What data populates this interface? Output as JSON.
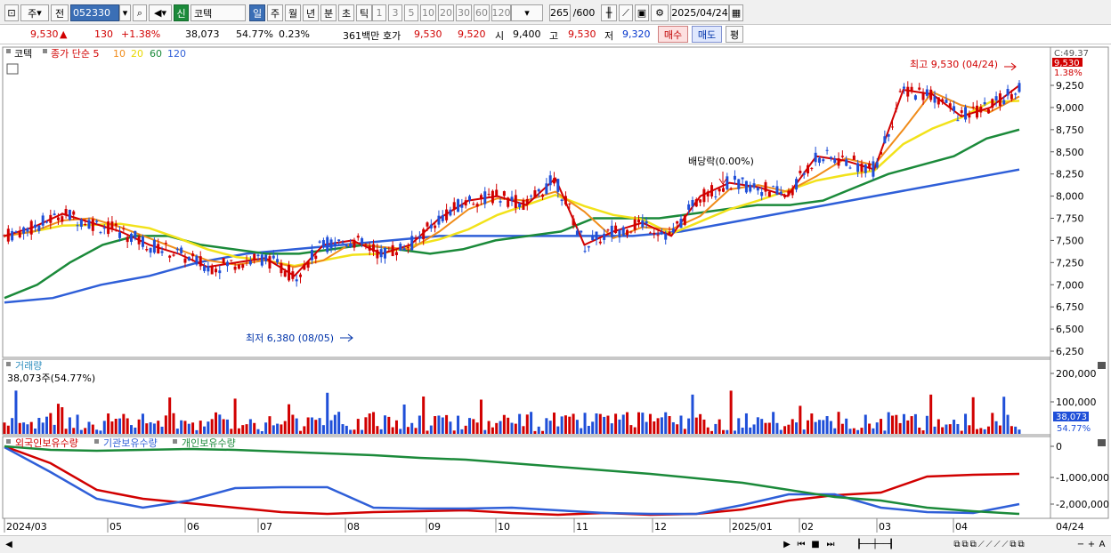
{
  "toolbar": {
    "period_main": "주",
    "prev_label": "전",
    "code": "052330",
    "new_label": "신",
    "name": "코텍",
    "tabs": [
      "일",
      "주",
      "월",
      "년",
      "분",
      "초",
      "틱"
    ],
    "active_tab": "일",
    "intervals": [
      "1",
      "3",
      "5",
      "10",
      "20",
      "30",
      "60",
      "120"
    ],
    "count": "265",
    "count_total": "/600",
    "date": "2025/04/24"
  },
  "quote": {
    "price": "9,530",
    "arrow": "▲",
    "change": "130",
    "change_pct": "+1.38%",
    "volume": "38,073",
    "vol_ratio": "54.77%",
    "turnover": "0.23%",
    "amount": "361백만",
    "bid_label": "호가",
    "ask": "9,530",
    "bid": "9,520",
    "open_label": "시",
    "open": "9,400",
    "high_label": "고",
    "high": "9,530",
    "low_label": "저",
    "low": "9,320",
    "buy_button": "매수",
    "sell_button": "매도",
    "eval_button": "평"
  },
  "legend": {
    "name": "코텍",
    "ma_label": "종가 단순 5",
    "ma10": "10",
    "ma20": "20",
    "ma60": "60",
    "ma120": "120"
  },
  "annotations": {
    "high": "최고 9,530 (04/24)",
    "low": "최저 6,380 (08/05)",
    "dividend": "배당락(0.00%)"
  },
  "right_panel": {
    "top_code": "C:49.37",
    "price_box": "9,530",
    "pct": "1.38%",
    "vol_box": "38,073",
    "vol_pct": "54.77%"
  },
  "volume_panel": {
    "title": "거래량",
    "current": "38,073주(54.77%)"
  },
  "holding_panel": {
    "series": [
      "외국인보유수량",
      "기관보유수량",
      "개인보유수량"
    ]
  },
  "colors": {
    "up": "#d10000",
    "down": "#1f4fd8",
    "ma5": "#d10000",
    "ma10": "#f08c1a",
    "ma20": "#f2e21a",
    "ma60": "#1b8a3a",
    "ma120": "#2f5fd8"
  },
  "chart_data": {
    "type": "line",
    "price_axis": [
      "9,250",
      "9,000",
      "8,750",
      "8,500",
      "8,250",
      "8,000",
      "7,750",
      "7,500",
      "7,250",
      "7,000",
      "6,750",
      "6,500",
      "6,250"
    ],
    "price_axis_values": [
      9250,
      9000,
      8750,
      8500,
      8250,
      8000,
      7750,
      7500,
      7250,
      7000,
      6750,
      6500,
      6250
    ],
    "volume_axis": [
      "200,000",
      "100,000"
    ],
    "holding_axis": [
      "0",
      "-1,000,000",
      "-2,000,000"
    ],
    "x_ticks": [
      "2024/03",
      "05",
      "06",
      "07",
      "08",
      "09",
      "10",
      "11",
      "12",
      "2025/01",
      "02",
      "03",
      "04"
    ],
    "date_end": "04/24",
    "close_ma5": [
      7550,
      7650,
      7800,
      7700,
      7600,
      7450,
      7350,
      7200,
      7250,
      7300,
      7100,
      7450,
      7500,
      7350,
      7450,
      7750,
      7950,
      8000,
      7900,
      8200,
      7450,
      7600,
      7700,
      7550,
      8000,
      8150,
      8100,
      8000,
      8450,
      8400,
      8300,
      9200,
      9150,
      8900,
      9000,
      9250
    ],
    "ma60": [
      6850,
      7000,
      7250,
      7450,
      7550,
      7550,
      7450,
      7400,
      7350,
      7350,
      7400,
      7450,
      7400,
      7350,
      7400,
      7500,
      7550,
      7600,
      7750,
      7750,
      7750,
      7800,
      7850,
      7900,
      7900,
      7950,
      8100,
      8250,
      8350,
      8450,
      8650,
      8750
    ],
    "ma120": [
      6800,
      6850,
      7000,
      7100,
      7250,
      7350,
      7400,
      7450,
      7500,
      7550,
      7550,
      7550,
      7550,
      7550,
      7600,
      7700,
      7800,
      7900,
      8000,
      8100,
      8200,
      8300
    ]
  }
}
